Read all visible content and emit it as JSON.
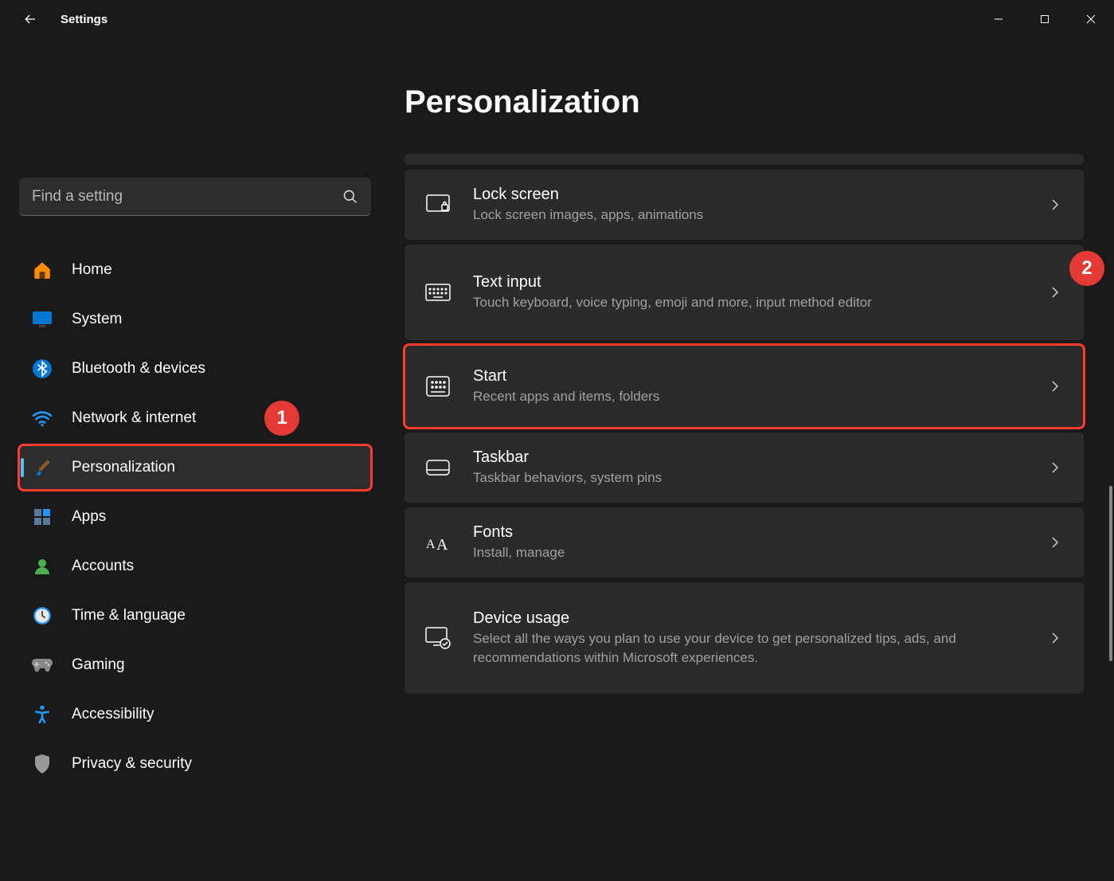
{
  "app_title": "Settings",
  "search": {
    "placeholder": "Find a setting"
  },
  "page_title": "Personalization",
  "sidebar": {
    "items": [
      {
        "label": "Home"
      },
      {
        "label": "System"
      },
      {
        "label": "Bluetooth & devices"
      },
      {
        "label": "Network & internet"
      },
      {
        "label": "Personalization"
      },
      {
        "label": "Apps"
      },
      {
        "label": "Accounts"
      },
      {
        "label": "Time & language"
      },
      {
        "label": "Gaming"
      },
      {
        "label": "Accessibility"
      },
      {
        "label": "Privacy & security"
      }
    ]
  },
  "cards": {
    "lock_screen": {
      "title": "Lock screen",
      "desc": "Lock screen images, apps, animations"
    },
    "text_input": {
      "title": "Text input",
      "desc": "Touch keyboard, voice typing, emoji and more, input method editor"
    },
    "start": {
      "title": "Start",
      "desc": "Recent apps and items, folders"
    },
    "taskbar": {
      "title": "Taskbar",
      "desc": "Taskbar behaviors, system pins"
    },
    "fonts": {
      "title": "Fonts",
      "desc": "Install, manage"
    },
    "device_usage": {
      "title": "Device usage",
      "desc": "Select all the ways you plan to use your device to get personalized tips, ads, and recommendations within Microsoft experiences."
    }
  },
  "annotations": {
    "one": "1",
    "two": "2"
  }
}
